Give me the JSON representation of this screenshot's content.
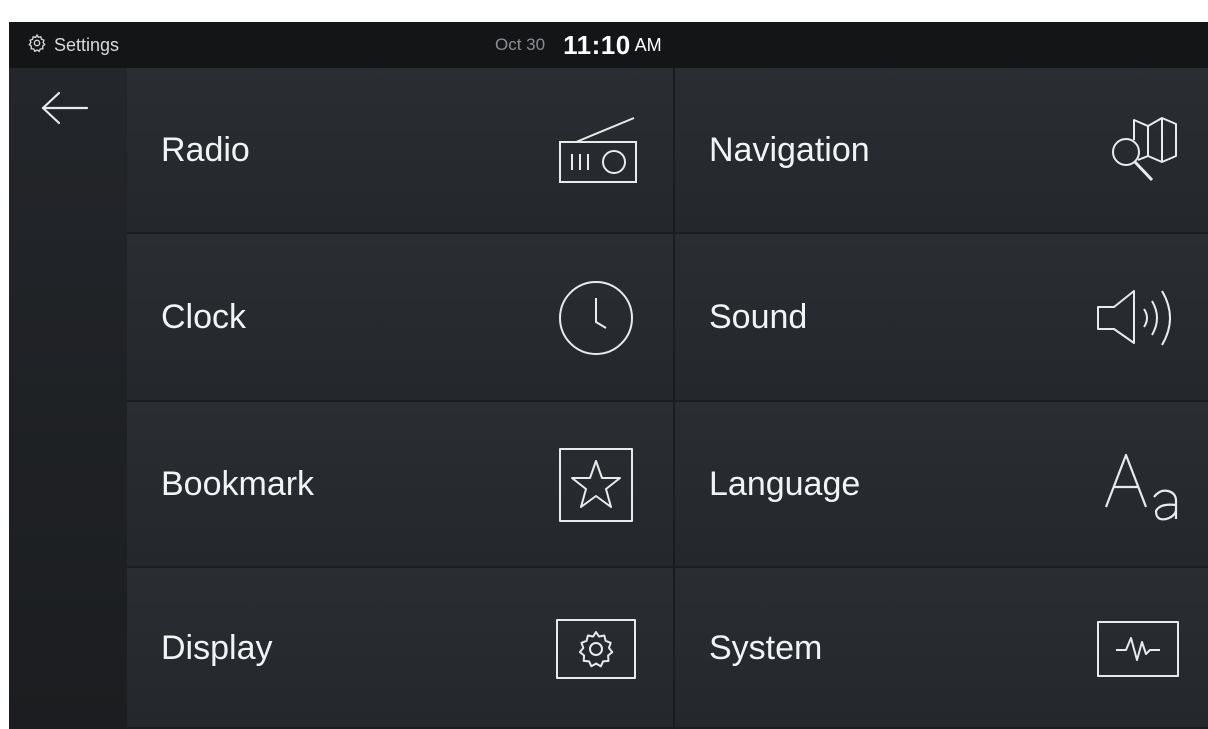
{
  "status": {
    "app_label": "Settings",
    "app_icon": "gear-icon",
    "date": "Oct 30",
    "time": "11:10",
    "ampm": "AM"
  },
  "nav": {
    "back_icon": "back-arrow-icon"
  },
  "menu": {
    "items": [
      {
        "label": "Radio",
        "icon": "radio-icon"
      },
      {
        "label": "Navigation",
        "icon": "map-search-icon"
      },
      {
        "label": "Clock",
        "icon": "clock-icon"
      },
      {
        "label": "Sound",
        "icon": "speaker-icon"
      },
      {
        "label": "Bookmark",
        "icon": "star-icon"
      },
      {
        "label": "Language",
        "icon": "font-aa-icon"
      },
      {
        "label": "Display",
        "icon": "display-gear-icon"
      },
      {
        "label": "System",
        "icon": "pulse-icon"
      }
    ]
  },
  "colors": {
    "background": "#1f2125",
    "tile": "#2a2d31",
    "text": "#f2f3f5",
    "statusbar": "#141517"
  }
}
